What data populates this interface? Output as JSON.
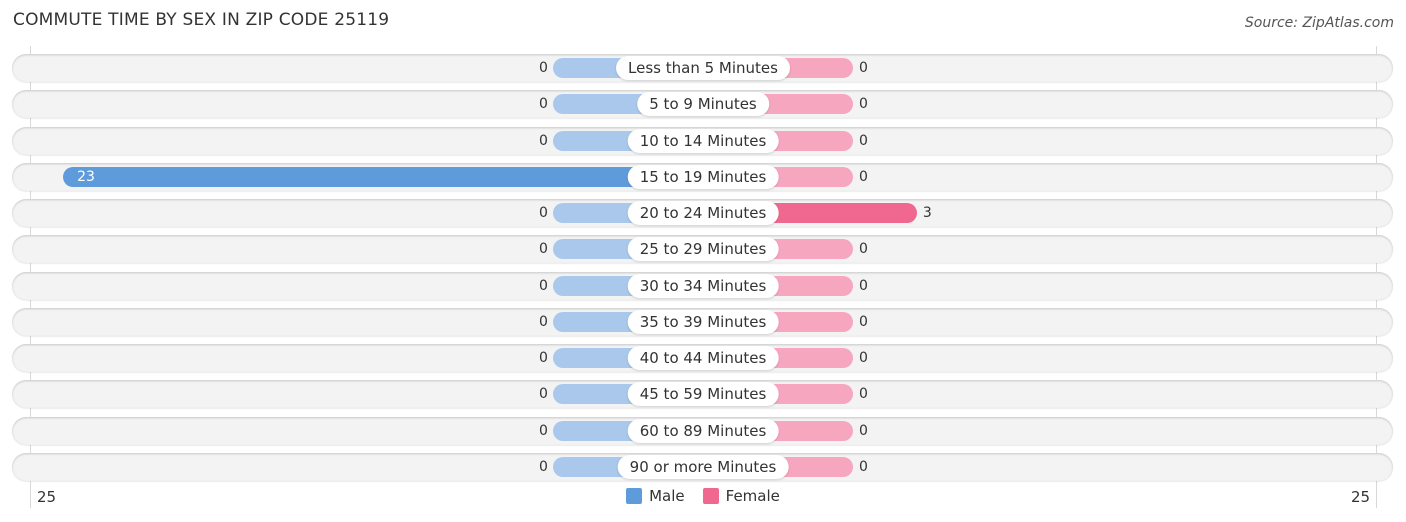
{
  "header": {
    "title": "COMMUTE TIME BY SEX IN ZIP CODE 25119",
    "source": "Source: ZipAtlas.com"
  },
  "colors": {
    "male": "#5e9bdb",
    "male_light": "#a9c8ec",
    "female": "#f06890",
    "female_light": "#f7a6c0"
  },
  "chart_data": {
    "type": "bar",
    "orientation": "horizontal-diverging",
    "title": "COMMUTE TIME BY SEX IN ZIP CODE 25119",
    "categories": [
      "Less than 5 Minutes",
      "5 to 9 Minutes",
      "10 to 14 Minutes",
      "15 to 19 Minutes",
      "20 to 24 Minutes",
      "25 to 29 Minutes",
      "30 to 34 Minutes",
      "35 to 39 Minutes",
      "40 to 44 Minutes",
      "45 to 59 Minutes",
      "60 to 89 Minutes",
      "90 or more Minutes"
    ],
    "series": [
      {
        "name": "Male",
        "values": [
          0,
          0,
          0,
          23,
          0,
          0,
          0,
          0,
          0,
          0,
          0,
          0
        ]
      },
      {
        "name": "Female",
        "values": [
          0,
          0,
          0,
          0,
          3,
          0,
          0,
          0,
          0,
          0,
          0,
          0
        ]
      }
    ],
    "xlim": [
      -25,
      25
    ],
    "tick_labels": {
      "left": "25",
      "right": "25"
    },
    "legend": {
      "position": "bottom-center",
      "entries": [
        "Male",
        "Female"
      ]
    },
    "grid": false
  }
}
